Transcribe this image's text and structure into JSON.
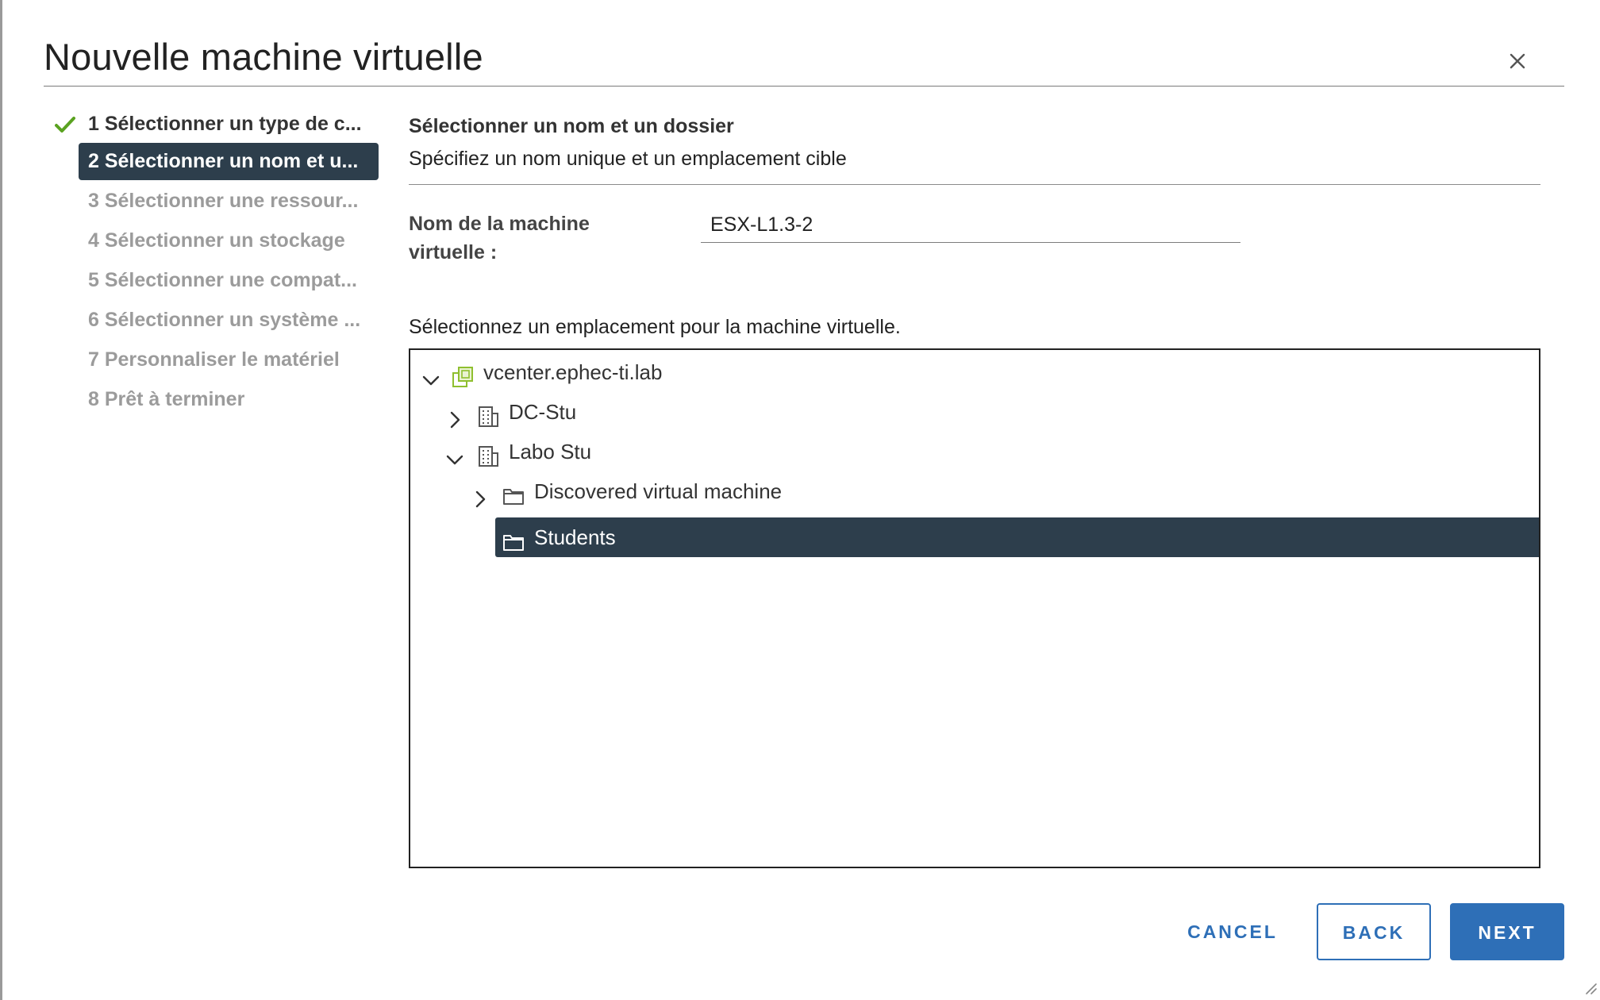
{
  "dialog": {
    "title": "Nouvelle machine virtuelle"
  },
  "steps": [
    {
      "label": "1 Sélectionner un type de c...",
      "state": "completed"
    },
    {
      "label": "2 Sélectionner un nom et u...",
      "state": "active"
    },
    {
      "label": "3 Sélectionner une ressour...",
      "state": "pending"
    },
    {
      "label": "4 Sélectionner un stockage",
      "state": "pending"
    },
    {
      "label": "5 Sélectionner une compat...",
      "state": "pending"
    },
    {
      "label": "6 Sélectionner un système ...",
      "state": "pending"
    },
    {
      "label": "7 Personnaliser le matériel",
      "state": "pending"
    },
    {
      "label": "8 Prêt à terminer",
      "state": "pending"
    }
  ],
  "main": {
    "section_title": "Sélectionner un nom et un dossier",
    "section_description": "Spécifiez un nom unique et un emplacement cible",
    "name_field": {
      "label": "Nom de la machine virtuelle :",
      "value": "ESX-L1.3-2"
    },
    "location_prompt": "Sélectionnez un emplacement pour la machine virtuelle.",
    "tree": [
      {
        "label": "vcenter.ephec-ti.lab",
        "icon": "vcenter-icon",
        "expanded": true
      },
      {
        "label": "DC-Stu",
        "icon": "datacenter-icon",
        "expanded": false
      },
      {
        "label": "Labo Stu",
        "icon": "datacenter-icon",
        "expanded": true
      },
      {
        "label": "Discovered virtual machine",
        "icon": "folder-icon",
        "expanded": false
      },
      {
        "label": "Students",
        "icon": "folder-icon",
        "selected": true
      }
    ]
  },
  "footer": {
    "cancel_label": "CANCEL",
    "back_label": "BACK",
    "next_label": "NEXT"
  },
  "colors": {
    "accent": "#2e6fb7",
    "selected_bg": "#2d3e4c",
    "check": "#5aa220",
    "vcenter_icon": "#8fbf2f"
  }
}
